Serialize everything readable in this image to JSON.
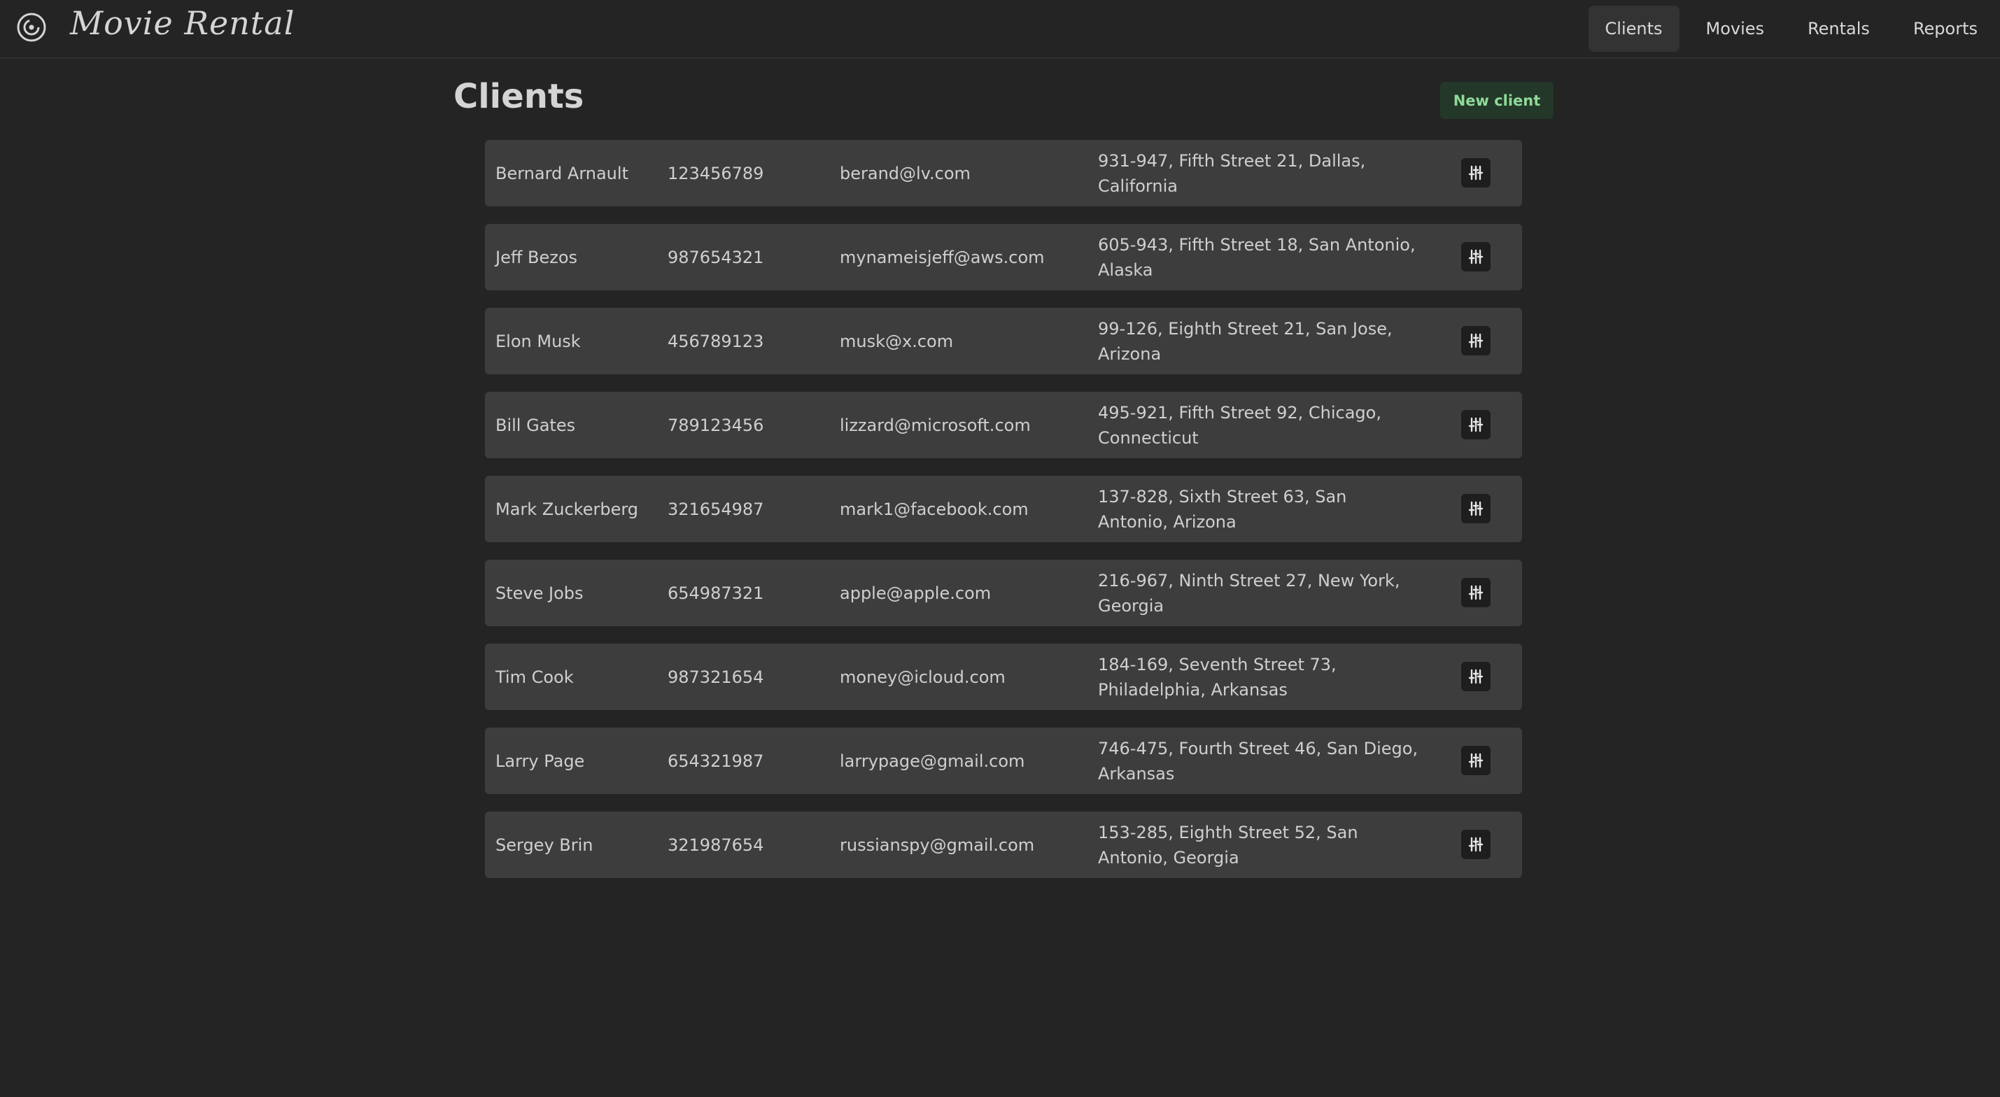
{
  "app": {
    "title": "Movie Rental"
  },
  "nav": [
    {
      "label": "Clients",
      "active": true
    },
    {
      "label": "Movies",
      "active": false
    },
    {
      "label": "Rentals",
      "active": false
    },
    {
      "label": "Reports",
      "active": false
    }
  ],
  "page": {
    "title": "Clients",
    "new_button": "New client"
  },
  "colors": {
    "background": "#242424",
    "row": "#3d3d3d",
    "accent_green": "#8fd99a"
  },
  "icons": {
    "logo": "film-reel-icon",
    "row_action": "sliders-icon"
  },
  "clients": [
    {
      "name": "Bernard Arnault",
      "phone": "123456789",
      "email": "berand@lv.com",
      "address": "931-947, Fifth Street 21, Dallas, California"
    },
    {
      "name": "Jeff Bezos",
      "phone": "987654321",
      "email": "mynameisjeff@aws.com",
      "address": "605-943, Fifth Street 18, San Antonio, Alaska"
    },
    {
      "name": "Elon Musk",
      "phone": "456789123",
      "email": "musk@x.com",
      "address": "99-126, Eighth Street 21, San Jose, Arizona"
    },
    {
      "name": "Bill Gates",
      "phone": "789123456",
      "email": "lizzard@microsoft.com",
      "address": "495-921, Fifth Street 92, Chicago, Connecticut"
    },
    {
      "name": "Mark Zuckerberg",
      "phone": "321654987",
      "email": "mark1@facebook.com",
      "address": "137-828, Sixth Street 63, San Antonio, Arizona"
    },
    {
      "name": "Steve Jobs",
      "phone": "654987321",
      "email": "apple@apple.com",
      "address": "216-967, Ninth Street 27, New York, Georgia"
    },
    {
      "name": "Tim Cook",
      "phone": "987321654",
      "email": "money@icloud.com",
      "address": "184-169, Seventh Street 73, Philadelphia, Arkansas"
    },
    {
      "name": "Larry Page",
      "phone": "654321987",
      "email": "larrypage@gmail.com",
      "address": "746-475, Fourth Street 46, San Diego, Arkansas"
    },
    {
      "name": "Sergey Brin",
      "phone": "321987654",
      "email": "russianspy@gmail.com",
      "address": "153-285, Eighth Street 52, San Antonio, Georgia"
    }
  ]
}
